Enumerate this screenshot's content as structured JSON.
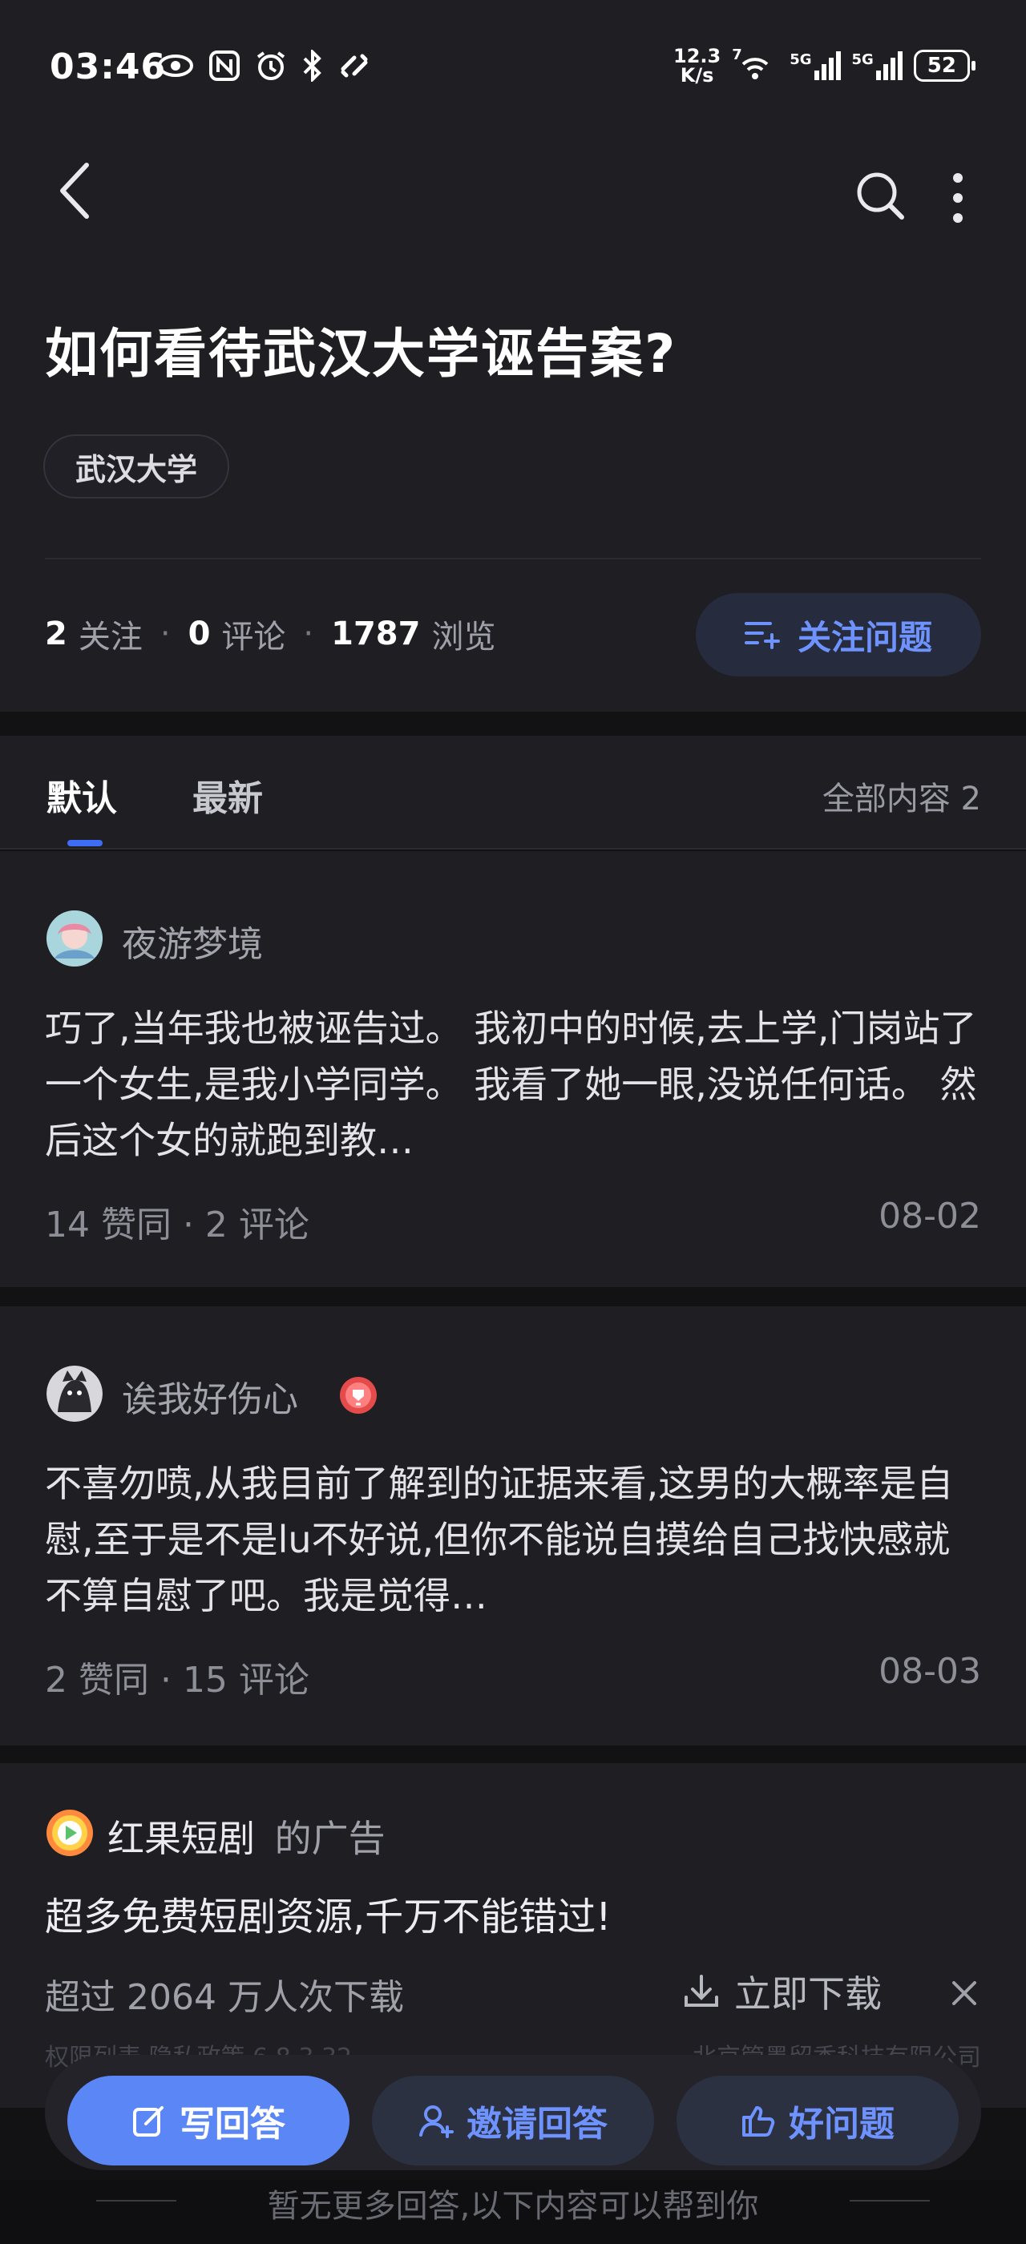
{
  "status_bar": {
    "time": "03:46",
    "net_speed_top": "12.3",
    "net_speed_bottom": "K/s",
    "wifi_label": "7",
    "signal1_label": "5G",
    "signal2_label": "5G",
    "battery": "52"
  },
  "question": {
    "title": "如何看待武汉大学诬告案?",
    "tag": "武汉大学",
    "follows_count": "2",
    "follows_label": "关注",
    "comments_count": "0",
    "comments_label": "评论",
    "views_count": "1787",
    "views_label": "浏览",
    "follow_button": "关注问题"
  },
  "tabs": {
    "default": "默认",
    "latest": "最新",
    "total": "全部内容 2"
  },
  "answers": [
    {
      "author": "夜游梦境",
      "excerpt": "巧了,当年我也被诬告过。 我初中的时候,去上学,门岗站了一个女生,是我小学同学。 我看了她一眼,没说任何话。 然后这个女的就跑到教…",
      "meta": "14 赞同 · 2 评论",
      "date": "08-02"
    },
    {
      "author": "诶我好伤心",
      "excerpt": "不喜勿喷,从我目前了解到的证据来看,这男的大概率是自慰,至于是不是lu不好说,但你不能说自摸给自己找快感就不算自慰了吧。我是觉得…",
      "meta": "2 赞同 · 15 评论",
      "date": "08-03"
    }
  ],
  "ad": {
    "brand": "红果短剧",
    "suffix": "的广告",
    "title": "超多免费短剧资源,千万不能错过!",
    "subtitle": "超过 2064 万人次下载",
    "download": "立即下载",
    "footer_left": "权限列表 隐私政策 6.8.3.32",
    "footer_right": "北京管墨留香科技有限公司"
  },
  "bottom_bar": {
    "write": "写回答",
    "invite": "邀请回答",
    "good": "好问题"
  },
  "footer_hint": "暂无更多回答,以下内容可以帮到你",
  "colors": {
    "accent": "#3d6cf7",
    "accent_text": "#6e93ff",
    "primary_button": "#5b86f5",
    "card_bg": "#1e1e23",
    "page_bg": "#121214"
  }
}
